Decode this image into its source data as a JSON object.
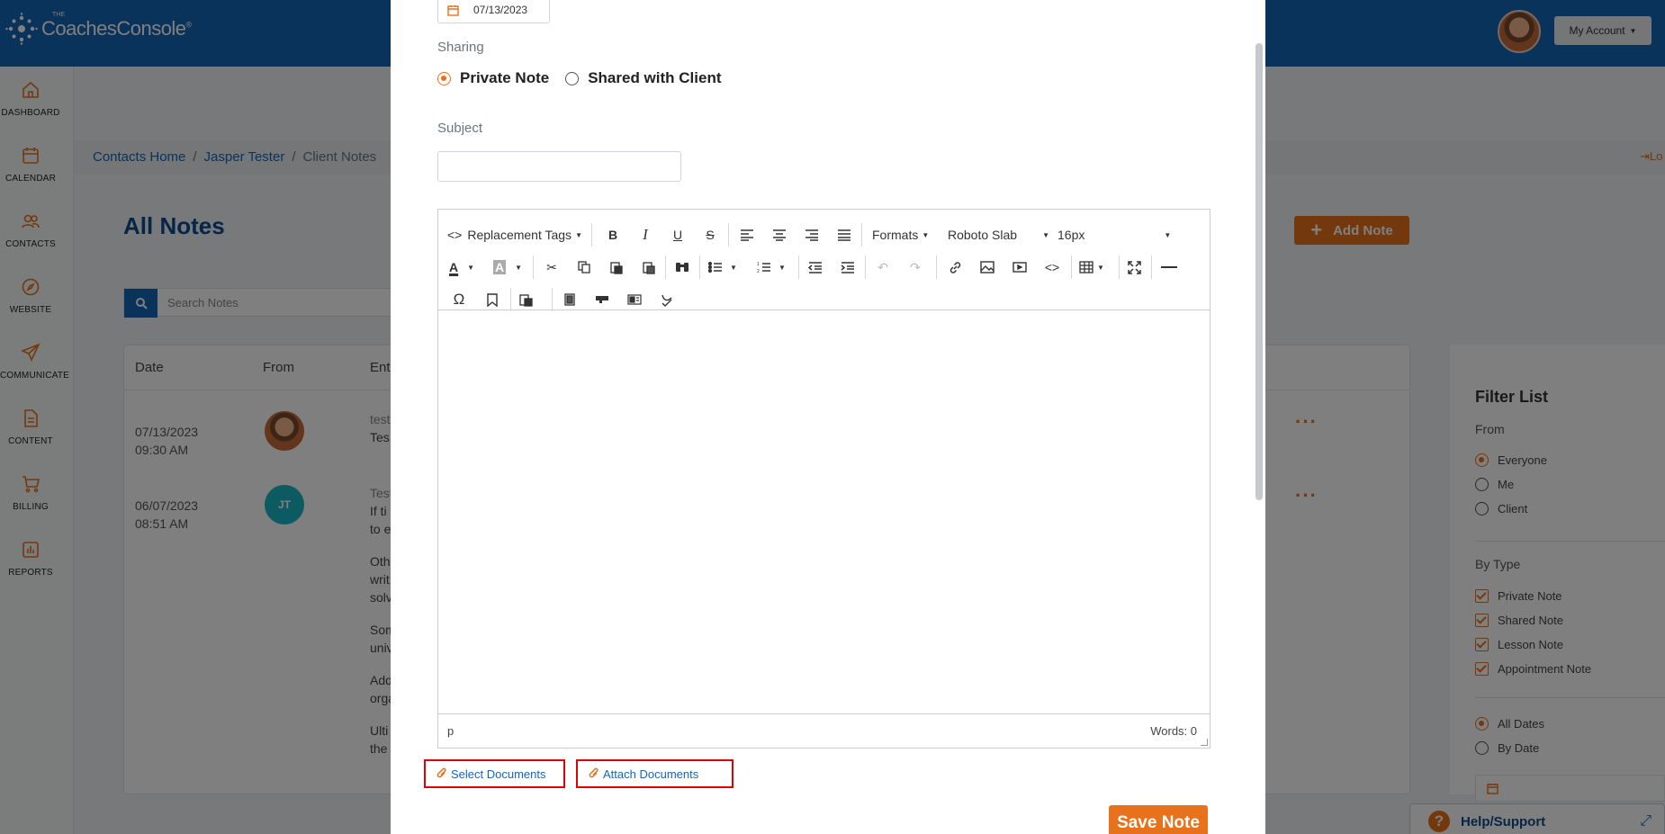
{
  "header": {
    "logo_small": "THE",
    "logo_text": "CoachesConsole",
    "logo_reg": "®",
    "account_label": "My Account"
  },
  "sidebar": {
    "items": [
      {
        "label": "DASHBOARD",
        "icon": "home-icon"
      },
      {
        "label": "CALENDAR",
        "icon": "calendar-icon"
      },
      {
        "label": "CONTACTS",
        "icon": "users-icon"
      },
      {
        "label": "WEBSITE",
        "icon": "compass-icon"
      },
      {
        "label": "COMMUNICATE",
        "icon": "send-icon"
      },
      {
        "label": "CONTENT",
        "icon": "document-icon"
      },
      {
        "label": "BILLING",
        "icon": "cart-icon"
      },
      {
        "label": "REPORTS",
        "icon": "bar-chart-icon"
      }
    ]
  },
  "breadcrumb": {
    "home": "Contacts Home",
    "contact": "Jasper Tester",
    "current": "Client Notes",
    "logout": "Lo"
  },
  "page": {
    "title": "All Notes",
    "add_note": "Add Note",
    "search_placeholder": "Search Notes"
  },
  "notes_table": {
    "columns": [
      "Date",
      "From",
      "Ent"
    ],
    "rows": [
      {
        "date": "07/13/2023",
        "time": "09:30 AM",
        "avatar": "photo",
        "lines": [
          "test",
          "Tes"
        ]
      },
      {
        "date": "06/07/2023",
        "time": "08:51 AM",
        "avatar": "JT",
        "lines": [
          "Test",
          "If ti",
          "to e",
          "Oth",
          "writ",
          "solv",
          "Som",
          "univ",
          "Add",
          "orga",
          "Ulti",
          "the"
        ]
      }
    ]
  },
  "filter": {
    "title": "Filter List",
    "from_label": "From",
    "from_options": [
      {
        "label": "Everyone",
        "checked": true
      },
      {
        "label": "Me",
        "checked": false
      },
      {
        "label": "Client",
        "checked": false
      }
    ],
    "type_label": "By Type",
    "type_options": [
      "Private Note",
      "Shared Note",
      "Lesson Note",
      "Appointment Note"
    ],
    "date_options": [
      {
        "label": "All Dates",
        "checked": true
      },
      {
        "label": "By Date",
        "checked": false
      }
    ]
  },
  "help": {
    "label": "Help/Support"
  },
  "modal": {
    "date_value": "07/13/2023",
    "sharing_label": "Sharing",
    "sharing_options": [
      {
        "label": "Private Note",
        "checked": true
      },
      {
        "label": "Shared with Client",
        "checked": false
      }
    ],
    "subject_label": "Subject",
    "subject_value": "",
    "editor": {
      "replacement_tags": "Replacement Tags",
      "formats": "Formats",
      "font": "Roboto Slab",
      "size": "16px",
      "status_path": "p",
      "word_count": "Words: 0"
    },
    "select_documents": "Select Documents",
    "attach_documents": "Attach Documents",
    "save_label": "Save Note"
  },
  "colors": {
    "brand_blue": "#1467b8",
    "accent_orange": "#e8711b",
    "highlight_red": "#e30000"
  }
}
